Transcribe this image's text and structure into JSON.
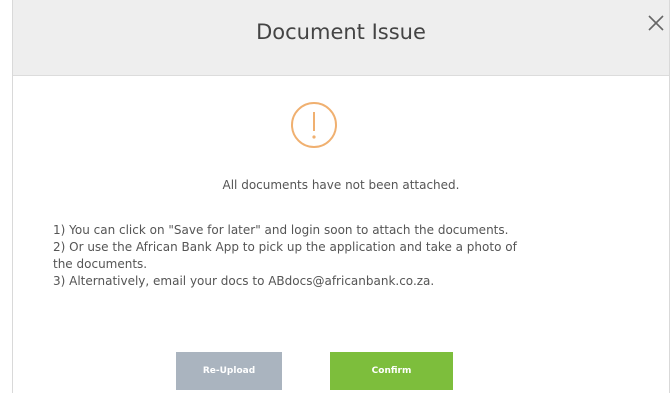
{
  "dialog": {
    "title": "Document Issue",
    "close_icon": "close-icon",
    "warning_icon": "exclamation-circle-icon",
    "message": "All documents have not been attached.",
    "instructions": [
      "1) You can click on \"Save for later\" and login soon to attach the documents.",
      "2) Or use the African Bank App to pick up the application and take a photo of",
      "the documents.",
      "3) Alternatively, email your docs to ABdocs@africanbank.co.za."
    ],
    "buttons": {
      "reupload_label": "Re-Upload",
      "confirm_label": "Confirm"
    }
  },
  "colors": {
    "header_bg": "#eeeeee",
    "warning_orange": "#f0b070",
    "reupload_bg": "#aab4bf",
    "confirm_bg": "#7dbe3c"
  }
}
